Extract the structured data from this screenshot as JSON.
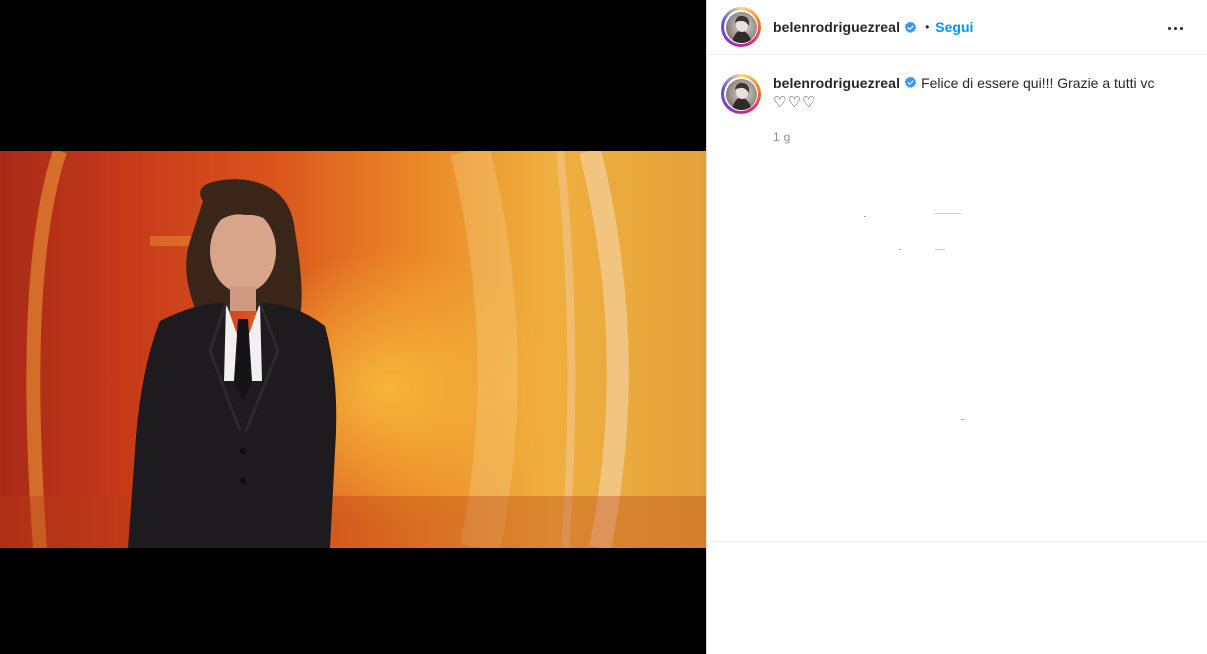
{
  "post": {
    "username": "belenrodriguezreal",
    "follow_label": "Segui",
    "separator": "•",
    "caption": "Felice di essere qui!!! Grazie a tutti vc",
    "hearts": "♡♡♡",
    "time": "1 g"
  },
  "icons": {
    "verified": "verified-badge-icon",
    "more": "more-options-icon"
  },
  "colors": {
    "accent": "#0095f6",
    "verified": "#3897f0",
    "text": "#262626",
    "muted": "#8e8e8e",
    "media_background": "#000000"
  }
}
